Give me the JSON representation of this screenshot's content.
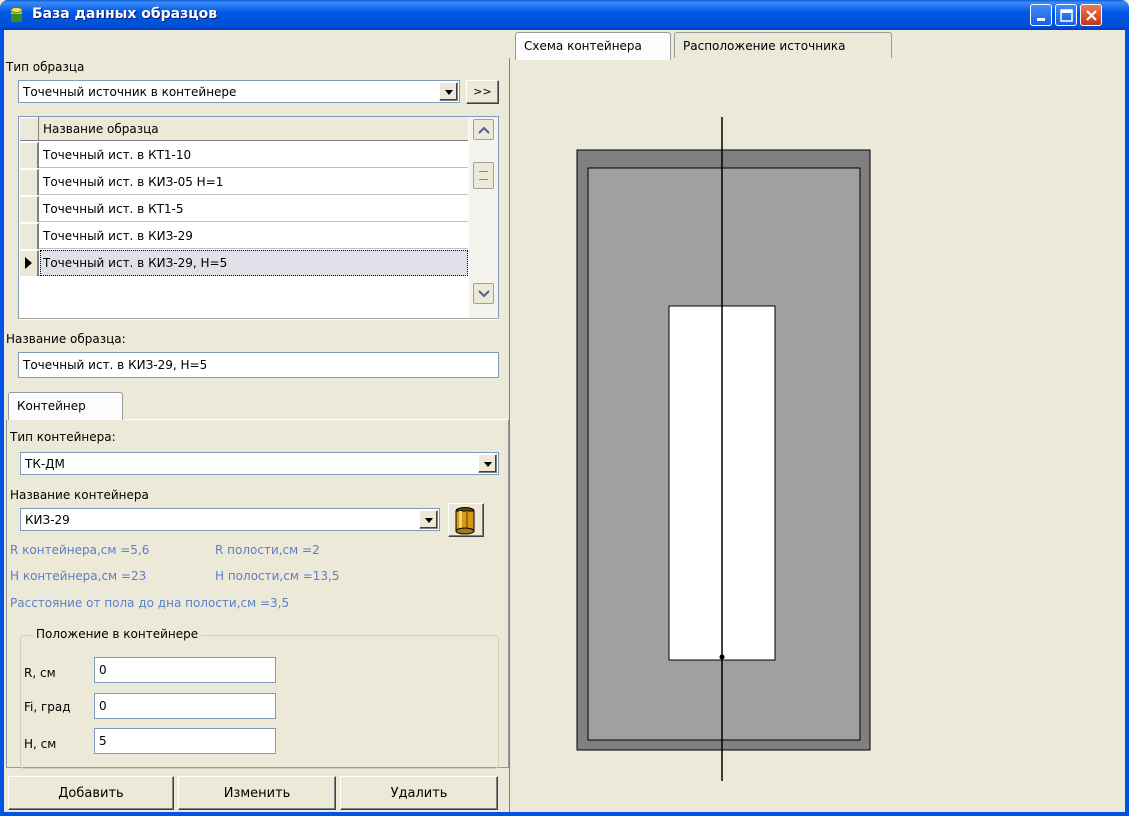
{
  "window": {
    "title": "База данных образцов"
  },
  "sample_type": {
    "label": "Тип образца",
    "value": "Точечный источник в контейнере",
    "more_button": ">>"
  },
  "sample_table": {
    "header": "Название образца",
    "rows": [
      "Точечный ист. в КТ1-10",
      "Точечный ист. в КИЗ-05 Н=1",
      "Точечный ист. в КТ1-5",
      "Точечный ист. в КИЗ-29",
      "Точечный ист. в КИЗ-29, Н=5"
    ],
    "selected_index": 4
  },
  "sample_name": {
    "label": "Название образца:",
    "value": "Точечный ист. в КИЗ-29, Н=5"
  },
  "container_tab": {
    "label": "Контейнер"
  },
  "container_type": {
    "label": "Тип контейнера:",
    "value": "ТК-ДМ"
  },
  "container_name": {
    "label": "Название контейнера",
    "value": "КИЗ-29"
  },
  "container_info": {
    "r_container": "R контейнера,см =5,6",
    "r_cavity": "R полости,см =2",
    "h_container": "H контейнера,см =23",
    "h_cavity": "H полости,см =13,5",
    "floor_distance": "Расстояние от пола до дна полости,см =3,5"
  },
  "position": {
    "legend": "Положение в контейнере",
    "r": {
      "label": "R, см",
      "value": "0"
    },
    "fi": {
      "label": "Fi, град",
      "value": "0"
    },
    "h": {
      "label": "H, см",
      "value": "5"
    }
  },
  "buttons": {
    "add": "Добавить",
    "edit": "Изменить",
    "delete": "Удалить"
  },
  "right_tabs": {
    "scheme": "Схема контейнера",
    "source_position": "Расположение источника"
  },
  "colors": {
    "container_outer": "#808080",
    "container_inner": "#a0a0a0",
    "cavity": "#ffffff",
    "axis": "#000000"
  }
}
